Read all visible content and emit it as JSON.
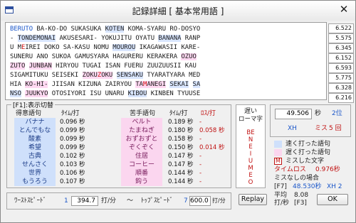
{
  "window": {
    "title": "記録詳細 [ 基本常用語 ]",
    "close_glyph": "✕"
  },
  "text_lines": [
    "BERUTO BA-KO-DO SUKASUKA KOTEN KOMA-SYARU RO-DOSYO",
    "- TONDEMONAI AKUSESARI- YOKUJITU OYATU BANANA RANP",
    "U MEIREI DOKO SA-KASU NOMU MOUROU IKAGAWASII KARE-",
    "SUNERU ANO SUKOA GAMUSYARA HAGURERU KERAKERA OZUO",
    "ZUTO JUNBAN HIRYOU TUGAI ISAN FUERU ZUUZUUSII KAU",
    "SIGAMITUKU SEISEKI ZOKUZOKU SENSAKU TYARATYARA MED",
    "HIA KO-HI- JIISAN KIZUNA ZAIRYOU TAMANEGI SEKAI SA",
    "NSO JUUKYO OTOSIYORI ISU UNARU KIBOU KINBEN TYUUSE"
  ],
  "line_times": [
    "6.522",
    "5.575",
    "6.345",
    "6.152",
    "6.593",
    "5.775",
    "6.328",
    "6.216"
  ],
  "word_section": {
    "label": "[F1]:表示切替",
    "good_header": "得意語句",
    "bad_header": "苦手語句",
    "time_header": "ﾀｲﾑ/打",
    "loss_header": "ﾛｽ/打",
    "good": [
      {
        "word": "バナナ",
        "time": "0.096 秒"
      },
      {
        "word": "とんでもな",
        "time": "0.099 秒"
      },
      {
        "word": "酸素",
        "time": "0.099 秒"
      },
      {
        "word": "希望",
        "time": "0.099 秒"
      },
      {
        "word": "古典",
        "time": "0.102 秒"
      },
      {
        "word": "せんさく",
        "time": "0.103 秒"
      },
      {
        "word": "世界",
        "time": "0.106 秒"
      },
      {
        "word": "もうろう",
        "time": "0.107 秒"
      }
    ],
    "bad": [
      {
        "word": "ベルト",
        "time": "0.189 秒",
        "loss": "-"
      },
      {
        "word": "たまねぎ",
        "time": "0.180 秒",
        "loss": "0.058 秒"
      },
      {
        "word": "おずおずと",
        "time": "0.158 秒",
        "loss": "-"
      },
      {
        "word": "ぞくぞく",
        "time": "0.150 秒",
        "loss": "0.014 秒"
      },
      {
        "word": "住居",
        "time": "0.147 秒",
        "loss": "-"
      },
      {
        "word": "コーヒー",
        "time": "0.147 秒",
        "loss": "-"
      },
      {
        "word": "順番",
        "time": "0.144 秒",
        "loss": "-"
      },
      {
        "word": "鈎う",
        "time": "0.144 秒",
        "loss": "-"
      }
    ]
  },
  "slow_romaji": {
    "title_line1": "遅い",
    "title_line2": "ローマ字",
    "letters": [
      "BE",
      "N",
      "E",
      "I",
      "U",
      "M",
      "E",
      "O"
    ]
  },
  "result": {
    "time_value": "49.506",
    "time_unit": "秒",
    "rank": "2位",
    "xh_label": "XH",
    "miss_label": "ミス",
    "miss_count": "5 回",
    "legend_fast": "速く打った語句",
    "legend_slow": "遅く打った語句",
    "legend_miss": "ミスした文字",
    "legend_miss_mark": "M",
    "time_loss_label": "タイムロス",
    "time_loss_value": "0.976秒",
    "no_miss_label": "ミスなしの場合",
    "f7_label": "[F7]",
    "f7_value": "48.530秒",
    "f7_rank": "XH 2",
    "avg_label": "平均",
    "avg_value": "8.08",
    "avg_unit": "打/秒",
    "f3_label": "[F3]",
    "ok_label": "OK",
    "replay_label": "Replay"
  },
  "speed_bar": {
    "worst_label": "ﾜｰｽﾄｽﾋﾟｰﾄﾞ",
    "worst_index": "1",
    "worst_value": "394.7",
    "worst_unit": "打/分",
    "tilde": "〜",
    "top_label": "ﾄｯﾌﾟｽﾋﾟｰﾄﾞ",
    "top_index": "7",
    "top_value": "600.0",
    "top_unit": "打/分"
  }
}
